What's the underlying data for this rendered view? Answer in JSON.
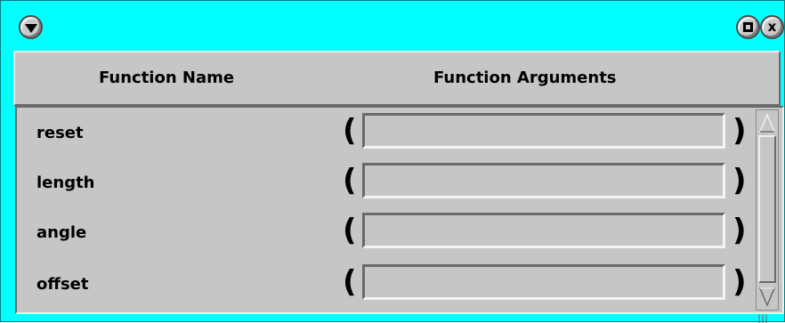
{
  "window": {
    "menu_icon": "triangle-down-icon",
    "maximize_icon": "square-icon",
    "close_icon": "x-icon",
    "close_glyph": "x"
  },
  "header": {
    "name_label": "Function Name",
    "args_label": "Function Arguments"
  },
  "functions": [
    {
      "name": "reset",
      "open_paren": "(",
      "close_paren": ")",
      "args": "",
      "placeholder": ""
    },
    {
      "name": "length",
      "open_paren": "(",
      "close_paren": ")",
      "args": "",
      "placeholder": ""
    },
    {
      "name": "angle",
      "open_paren": "(",
      "close_paren": ")",
      "args": "",
      "placeholder": ""
    },
    {
      "name": "offset",
      "open_paren": "(",
      "close_paren": ")",
      "args": "",
      "placeholder": ""
    }
  ],
  "colors": {
    "titlebar": "#00ffff",
    "panel": "#c6c6c6"
  }
}
